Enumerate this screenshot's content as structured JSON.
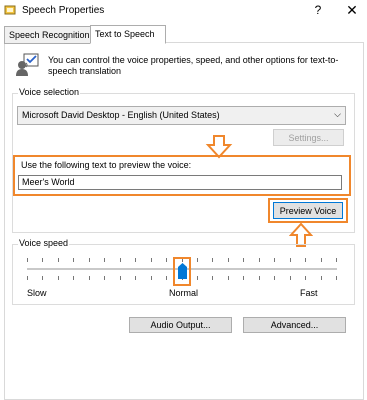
{
  "window": {
    "title": "Speech Properties",
    "help": "?",
    "close": "✕"
  },
  "tabs": [
    {
      "label": "Speech Recognition",
      "active": false
    },
    {
      "label": "Text to Speech",
      "active": true
    }
  ],
  "intro": {
    "text": "You can control the voice properties, speed, and other options for text-to-speech translation"
  },
  "voice_selection": {
    "label": "Voice selection",
    "selected_voice": "Microsoft David Desktop - English (United States)",
    "settings_label": "Settings...",
    "settings_enabled": false,
    "preview_prompt": "Use the following text to preview the voice:",
    "preview_text": "Meer's World",
    "preview_button": "Preview Voice"
  },
  "voice_speed": {
    "label": "Voice speed",
    "slow": "Slow",
    "normal": "Normal",
    "fast": "Fast",
    "level": 0.5
  },
  "buttons": {
    "audio_output": "Audio Output...",
    "advanced": "Advanced..."
  },
  "annotations": {
    "color": "#f0872c"
  }
}
